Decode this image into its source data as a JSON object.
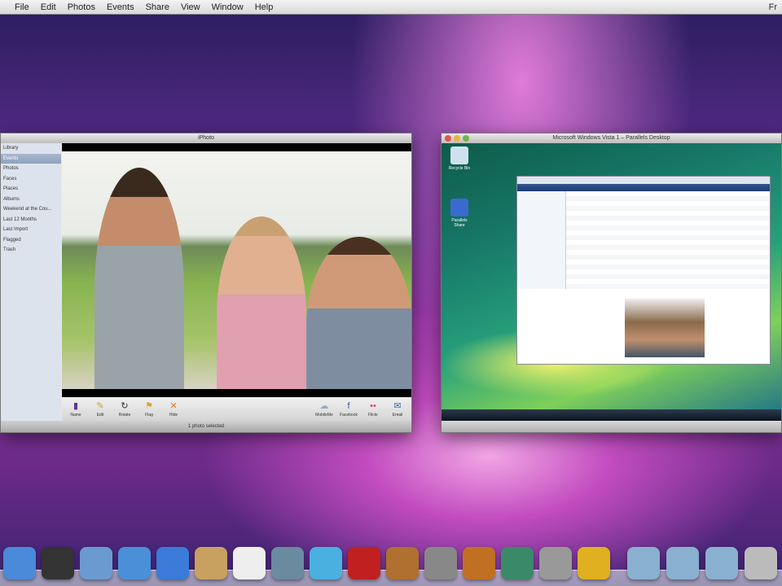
{
  "menubar": {
    "items": [
      "File",
      "Edit",
      "Photos",
      "Events",
      "Share",
      "View",
      "Window",
      "Help"
    ],
    "right": "Fr"
  },
  "iphoto": {
    "title": "iPhoto",
    "sidebar": [
      "Library",
      "Events",
      "Photos",
      "Faces",
      "Places",
      "Albums",
      "Weekend at the Cou...",
      "Last 12 Months",
      "Last Import",
      "Flagged",
      "Trash"
    ],
    "selected_index": 1,
    "toolbar_left": [
      {
        "label": "Name",
        "icon": "info-icon"
      },
      {
        "label": "Edit",
        "icon": "pencil-icon"
      },
      {
        "label": "Rotate",
        "icon": "rotate-icon"
      },
      {
        "label": "Flag",
        "icon": "flag-icon"
      },
      {
        "label": "Hide",
        "icon": "hide-x-icon"
      }
    ],
    "toolbar_right": [
      {
        "label": "MobileMe",
        "icon": "mobileme-icon"
      },
      {
        "label": "Facebook",
        "icon": "facebook-icon"
      },
      {
        "label": "Flickr",
        "icon": "flickr-icon"
      },
      {
        "label": "Email",
        "icon": "email-icon"
      }
    ],
    "status": "1 photo selected"
  },
  "parallels": {
    "title": "Microsoft Windows Vista 1 – Parallels Desktop",
    "desktop_icons": [
      "Recycle Bin",
      "Parallels Share"
    ]
  },
  "dock": {
    "apps": [
      "Finder",
      "Dashboard",
      "Preview",
      "Safari",
      "iChat",
      "Address Book",
      "iCal",
      "iPhoto",
      "iTunes",
      "Photo Booth",
      "Image Capture",
      "iMovie",
      "GarageBand",
      "Time Machine",
      "System Preferences",
      "Parallels",
      "Applications",
      "Documents",
      "Downloads",
      "Trash"
    ]
  }
}
